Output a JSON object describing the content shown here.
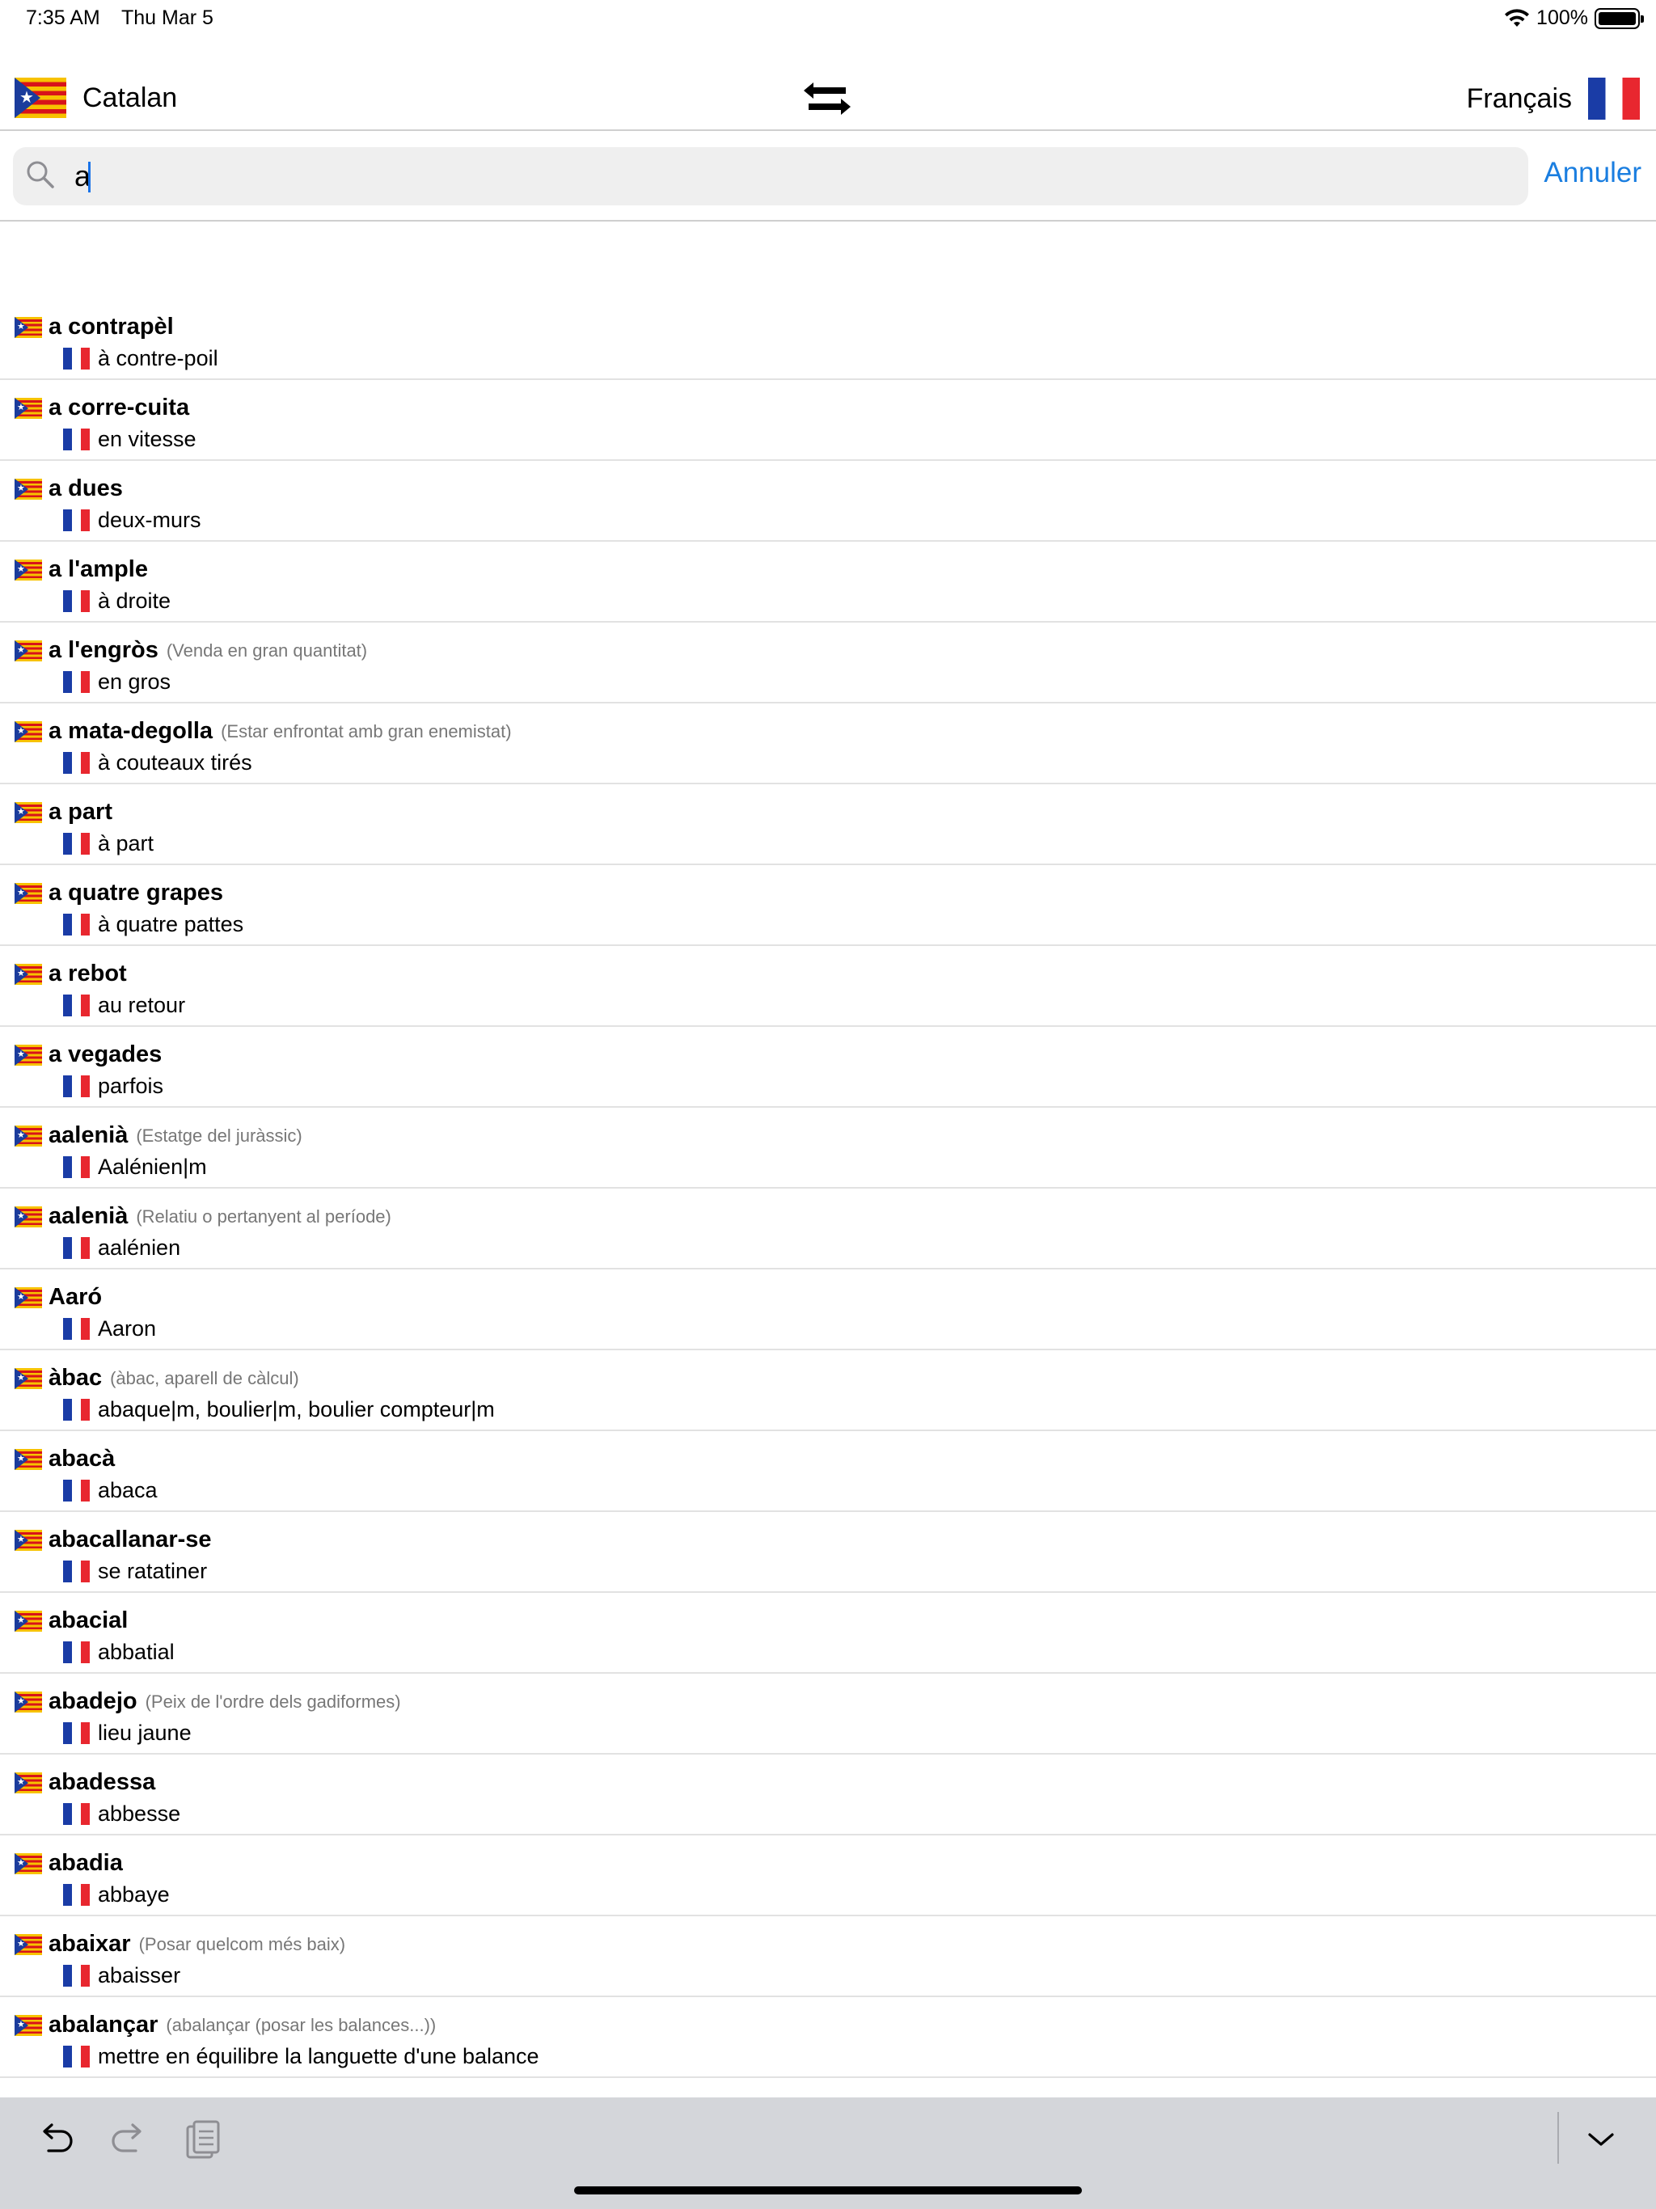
{
  "status_bar": {
    "time": "7:35 AM",
    "date": "Thu Mar 5",
    "battery": "100%"
  },
  "header": {
    "source_language": "Catalan",
    "target_language": "Français",
    "source_flag_icon": "catalan-flag-icon",
    "target_flag_icon": "french-flag-icon",
    "swap_icon": "swap-arrows-icon"
  },
  "search": {
    "value": "a",
    "cancel_label": "Annuler"
  },
  "results": [
    {
      "term": "a contrapèl",
      "note": "",
      "translation": "à contre-poil"
    },
    {
      "term": "a corre-cuita",
      "note": "",
      "translation": "en vitesse"
    },
    {
      "term": "a dues",
      "note": "",
      "translation": "deux-murs"
    },
    {
      "term": "a l'ample",
      "note": "",
      "translation": "à droite"
    },
    {
      "term": "a l'engròs",
      "note": "(Venda en gran quantitat)",
      "translation": "en gros"
    },
    {
      "term": "a mata-degolla",
      "note": "(Estar enfrontat amb gran enemistat)",
      "translation": "à couteaux tirés"
    },
    {
      "term": "a part",
      "note": "",
      "translation": "à part"
    },
    {
      "term": "a quatre grapes",
      "note": "",
      "translation": "à quatre pattes"
    },
    {
      "term": "a rebot",
      "note": "",
      "translation": "au retour"
    },
    {
      "term": "a vegades",
      "note": "",
      "translation": "parfois"
    },
    {
      "term": "aalenià",
      "note": "(Estatge del juràssic)",
      "translation": "Aalénien|m"
    },
    {
      "term": "aalenià",
      "note": "(Relatiu o pertanyent al període)",
      "translation": "aalénien"
    },
    {
      "term": "Aaró",
      "note": "",
      "translation": "Aaron"
    },
    {
      "term": "àbac",
      "note": "(àbac, aparell de càlcul)",
      "translation": "abaque|m, boulier|m, boulier compteur|m"
    },
    {
      "term": "abacà",
      "note": "",
      "translation": "abaca"
    },
    {
      "term": "abacallanar-se",
      "note": "",
      "translation": "se ratatiner"
    },
    {
      "term": "abacial",
      "note": "",
      "translation": "abbatial"
    },
    {
      "term": "abadejo",
      "note": "(Peix de l'ordre dels gadiformes)",
      "translation": "lieu jaune"
    },
    {
      "term": "abadessa",
      "note": "",
      "translation": "abbesse"
    },
    {
      "term": "abadia",
      "note": "",
      "translation": "abbaye"
    },
    {
      "term": "abaixar",
      "note": "(Posar quelcom més baix)",
      "translation": "abaisser"
    },
    {
      "term": "abalançar",
      "note": "(abalançar (posar les balances...))",
      "translation": "mettre en équilibre la languette d'une balance"
    }
  ],
  "keyboard_bar": {
    "undo_icon": "undo-icon",
    "redo_icon": "redo-icon",
    "paste_icon": "paste-icon",
    "dismiss_icon": "chevron-down-icon"
  }
}
